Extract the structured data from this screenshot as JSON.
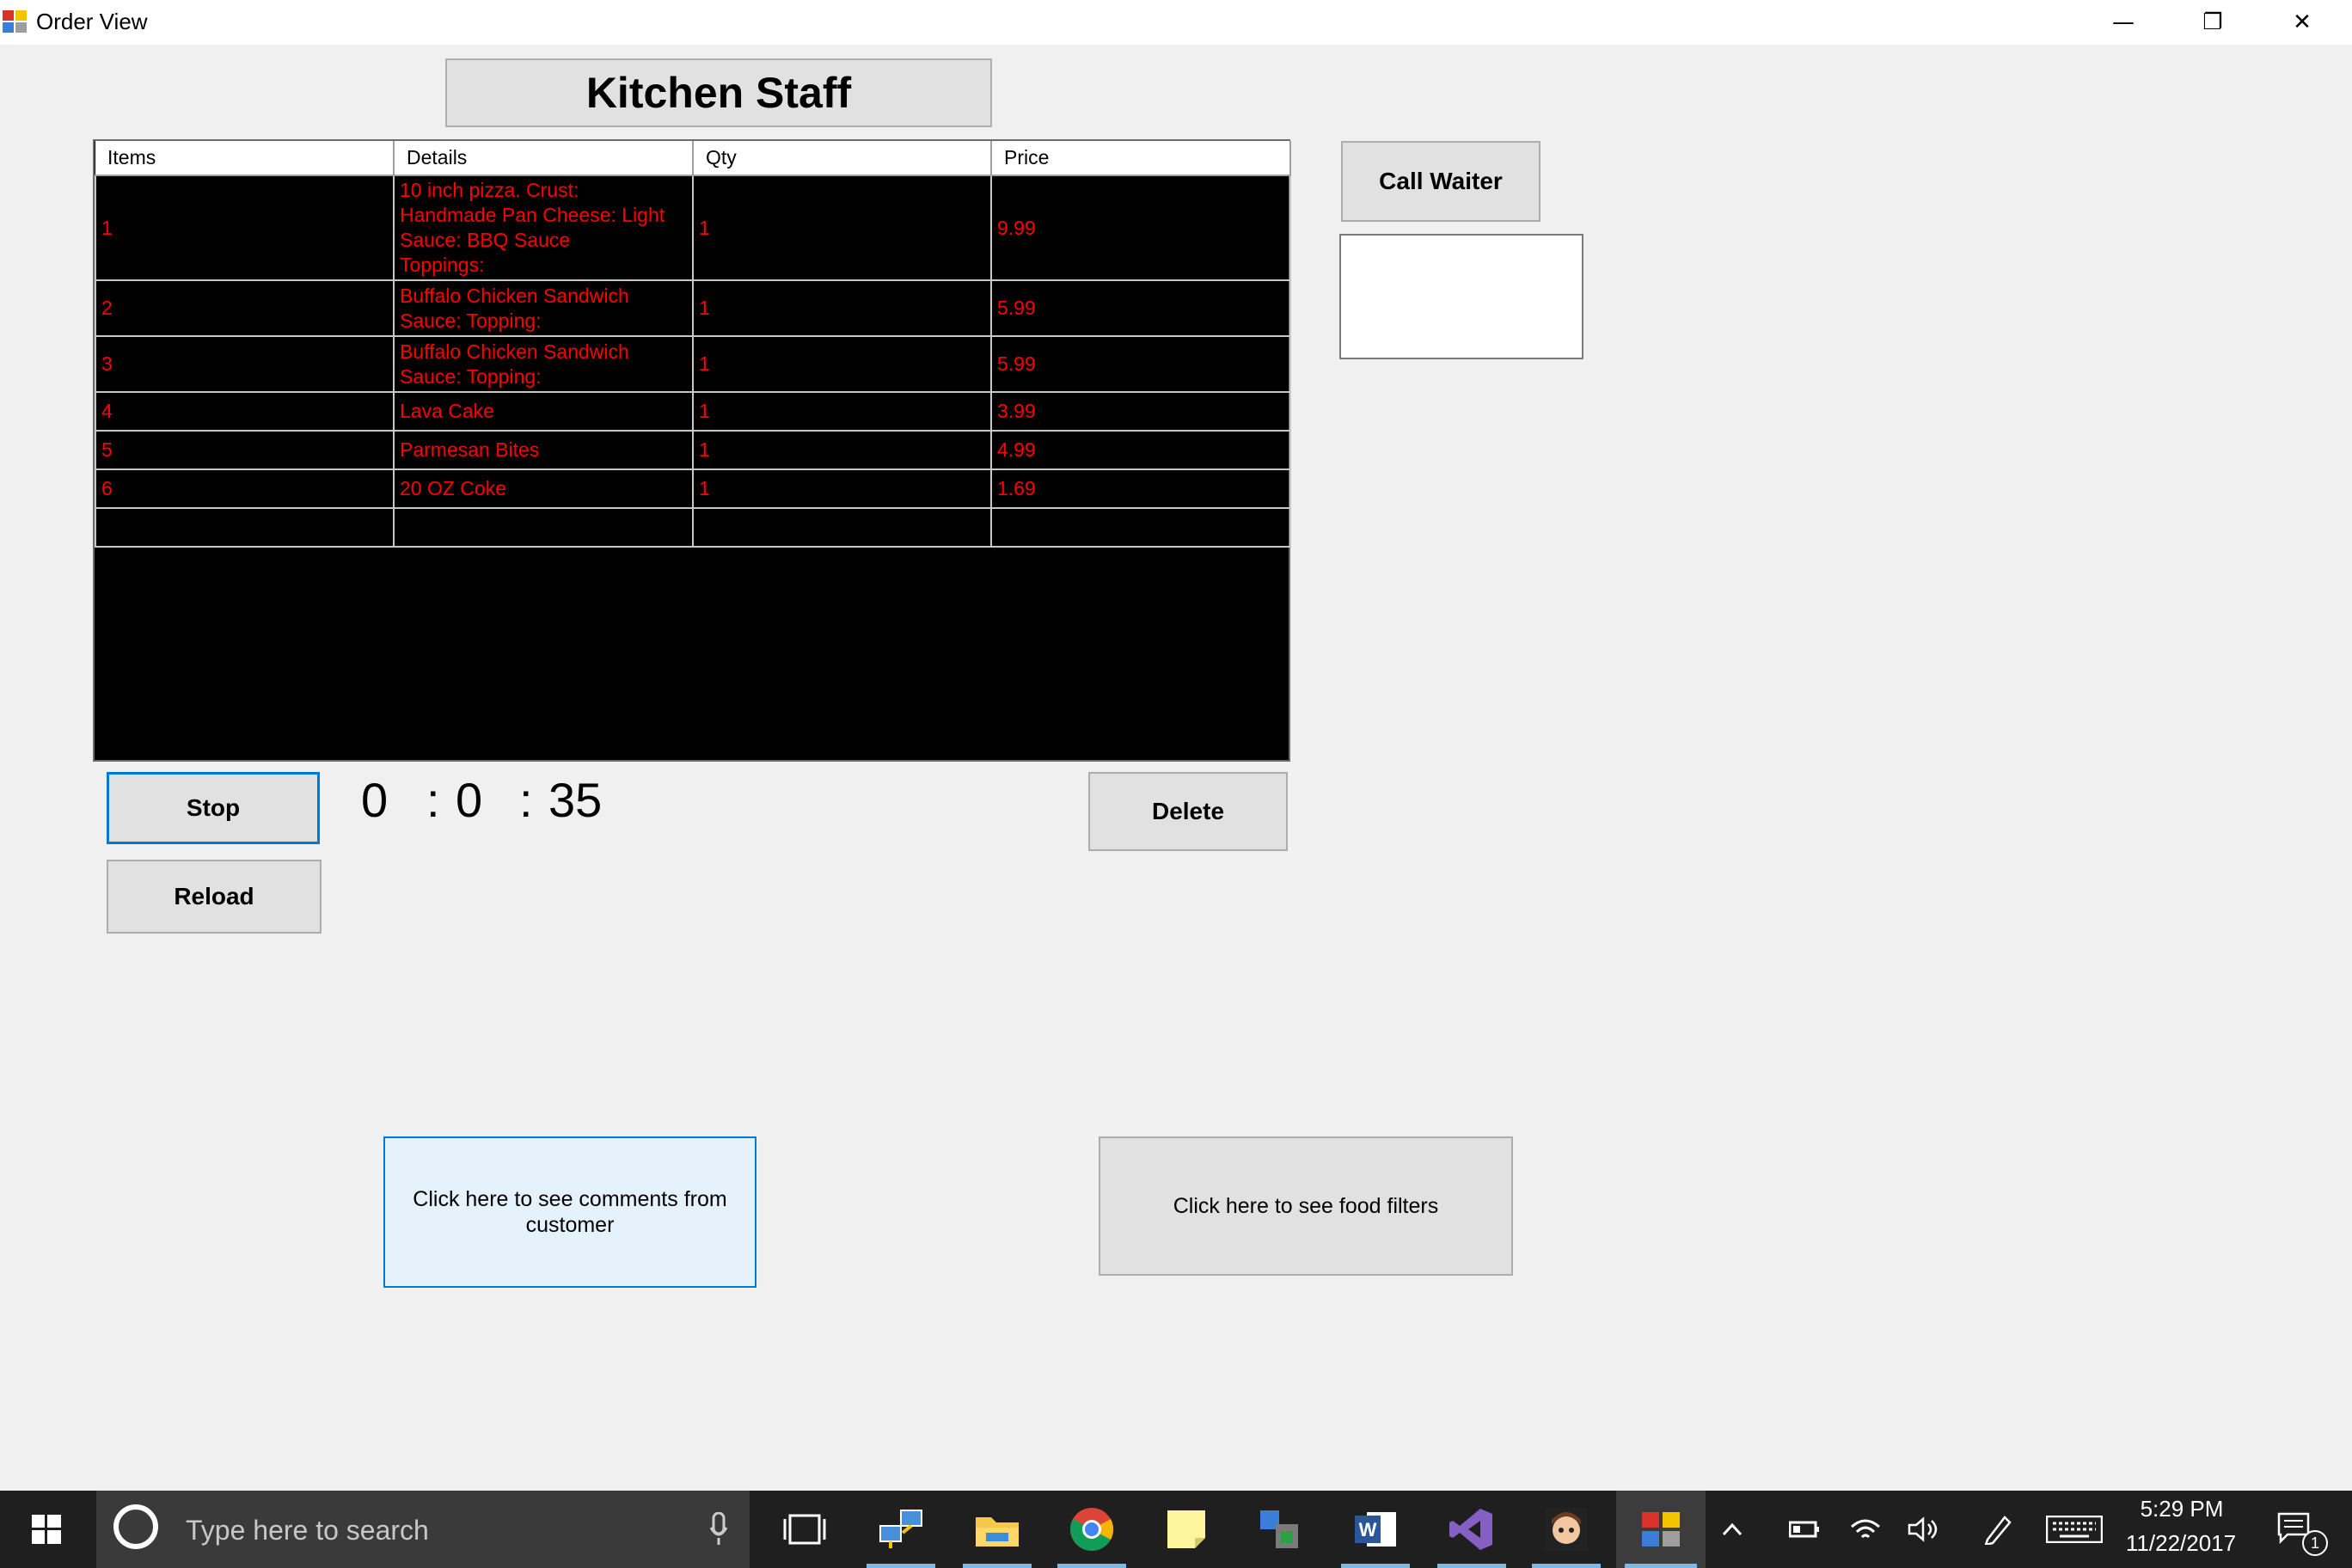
{
  "window": {
    "title": "Order View",
    "controls": {
      "minimize": "—",
      "maximize": "❐",
      "close": "✕"
    }
  },
  "header": {
    "label": "Kitchen Staff"
  },
  "grid": {
    "columns": [
      "Items",
      "Details",
      "Qty",
      "Price"
    ],
    "rows": [
      {
        "item": "1",
        "details": "10 inch pizza. Crust:\nHandmade Pan Cheese: Light\n   Sauce: BBQ Sauce\nToppings:",
        "qty": "1",
        "price": "9.99"
      },
      {
        "item": "2",
        "details": "Buffalo Chicken Sandwich\nSauce:  Topping:",
        "qty": "1",
        "price": "5.99"
      },
      {
        "item": "3",
        "details": "Buffalo Chicken Sandwich\nSauce:  Topping:",
        "qty": "1",
        "price": "5.99"
      },
      {
        "item": "4",
        "details": "Lava Cake",
        "qty": "1",
        "price": "3.99"
      },
      {
        "item": "5",
        "details": "Parmesan Bites",
        "qty": "1",
        "price": "4.99"
      },
      {
        "item": "6",
        "details": "20 OZ Coke",
        "qty": "1",
        "price": "1.69"
      },
      {
        "item": "",
        "details": "",
        "qty": "",
        "price": ""
      }
    ]
  },
  "buttons": {
    "call_waiter": "Call Waiter",
    "stop": "Stop",
    "reload": "Reload",
    "delete": "Delete",
    "comments": "Click here to see comments from customer",
    "filters": "Click here to see food filters"
  },
  "timer": {
    "hours": "0",
    "sep1": ":",
    "minutes": "0",
    "sep2": ":",
    "seconds": "35"
  },
  "taskbar": {
    "search_placeholder": "Type here to search",
    "time": "5:29 PM",
    "date": "11/22/2017",
    "notification_count": "1",
    "apps": [
      "task-view",
      "network-app",
      "file-explorer",
      "chrome",
      "sticky-notes",
      "tool-app",
      "word",
      "visual-studio",
      "game-app",
      "order-view-app"
    ]
  },
  "colors": {
    "grid_text": "#ff0000",
    "grid_bg": "#000000",
    "focus": "#0078d7"
  }
}
